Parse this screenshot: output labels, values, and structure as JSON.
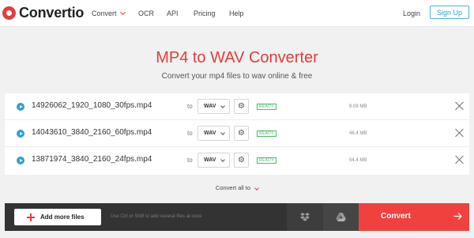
{
  "header": {
    "logo_text": "Convertio",
    "nav": {
      "convert": "Convert",
      "ocr": "OCR",
      "api": "API",
      "pricing": "Pricing",
      "help": "Help"
    },
    "login": "Login",
    "signup": "Sign Up"
  },
  "hero": {
    "title": "MP4 to WAV Converter",
    "subtitle": "Convert your mp4 files to wav online & free"
  },
  "files": [
    {
      "name": "14926062_1920_1080_30fps.mp4",
      "to": "to",
      "format": "WAV",
      "status": "READY",
      "size": "8.09 MB"
    },
    {
      "name": "14043610_3840_2160_60fps.mp4",
      "to": "to",
      "format": "WAV",
      "status": "READY",
      "size": "46.4 MB"
    },
    {
      "name": "13871974_3840_2160_24fps.mp4",
      "to": "to",
      "format": "WAV",
      "status": "READY",
      "size": "54.4 MB"
    }
  ],
  "convert_all": "Convert all to",
  "bottom_bar": {
    "add_files": "Add more files",
    "hint": "Use Ctrl or Shift to add several files at once",
    "convert": "Convert"
  },
  "colors": {
    "accent": "#e43c3c",
    "convert_button": "#f0413f",
    "link_blue": "#2d9fd8",
    "ready_green": "#4cbb6c",
    "bottom_bar": "#333333"
  },
  "icons": {
    "logo": "convertio-logo-icon",
    "play": "play-icon",
    "gear": "gear-icon",
    "close": "close-icon",
    "dropbox": "dropbox-icon",
    "drive": "google-drive-icon",
    "arrow": "arrow-right-icon"
  }
}
